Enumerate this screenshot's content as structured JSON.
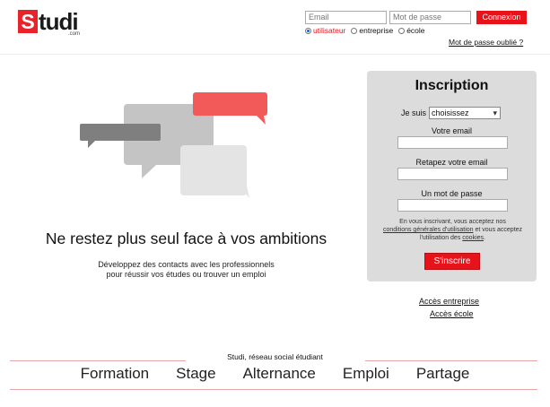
{
  "header": {
    "logo_initial": "S",
    "logo_rest": "tudi",
    "logo_suffix": ".com",
    "email_placeholder": "Email",
    "password_placeholder": "Mot de passe",
    "login_button": "Connexion",
    "account_types": [
      {
        "label": "utilisateur",
        "selected": true
      },
      {
        "label": "entreprise",
        "selected": false
      },
      {
        "label": "école",
        "selected": false
      }
    ],
    "forgot_password": "Mot de passe oublié ?"
  },
  "hero": {
    "tagline": "Ne restez plus seul face à vos ambitions",
    "subline_1": "Développez des contacts avec les professionnels",
    "subline_2": "pour réussir vos études ou trouver un emploi"
  },
  "signup": {
    "title": "Inscription",
    "je_suis_label": "Je suis",
    "je_suis_value": "choisissez",
    "email_label": "Votre email",
    "email_confirm_label": "Retapez votre email",
    "password_label": "Un mot de passe",
    "legal_prefix": "En vous inscrivant, vous acceptez nos",
    "legal_cgu": "conditions générales d'utilisation",
    "legal_middle": "et vous acceptez l'utilisation des",
    "legal_cookies": "cookies",
    "legal_end": ".",
    "submit_label": "S'inscrire"
  },
  "links": {
    "acces_entreprise": "Accès entreprise",
    "acces_ecole": "Accès école"
  },
  "footer": {
    "caption": "Studi, réseau social étudiant",
    "nav": [
      "Formation",
      "Stage",
      "Alternance",
      "Emploi",
      "Partage"
    ]
  },
  "colors": {
    "brand_red": "#e8131a",
    "panel_gray": "#dcdcdc",
    "footer_rule": "#e7a6aa",
    "bubble_dark": "#7f7f7f",
    "bubble_mid": "#c4c4c4",
    "bubble_light": "#e4e4e4",
    "bubble_red": "#f25a5a"
  }
}
